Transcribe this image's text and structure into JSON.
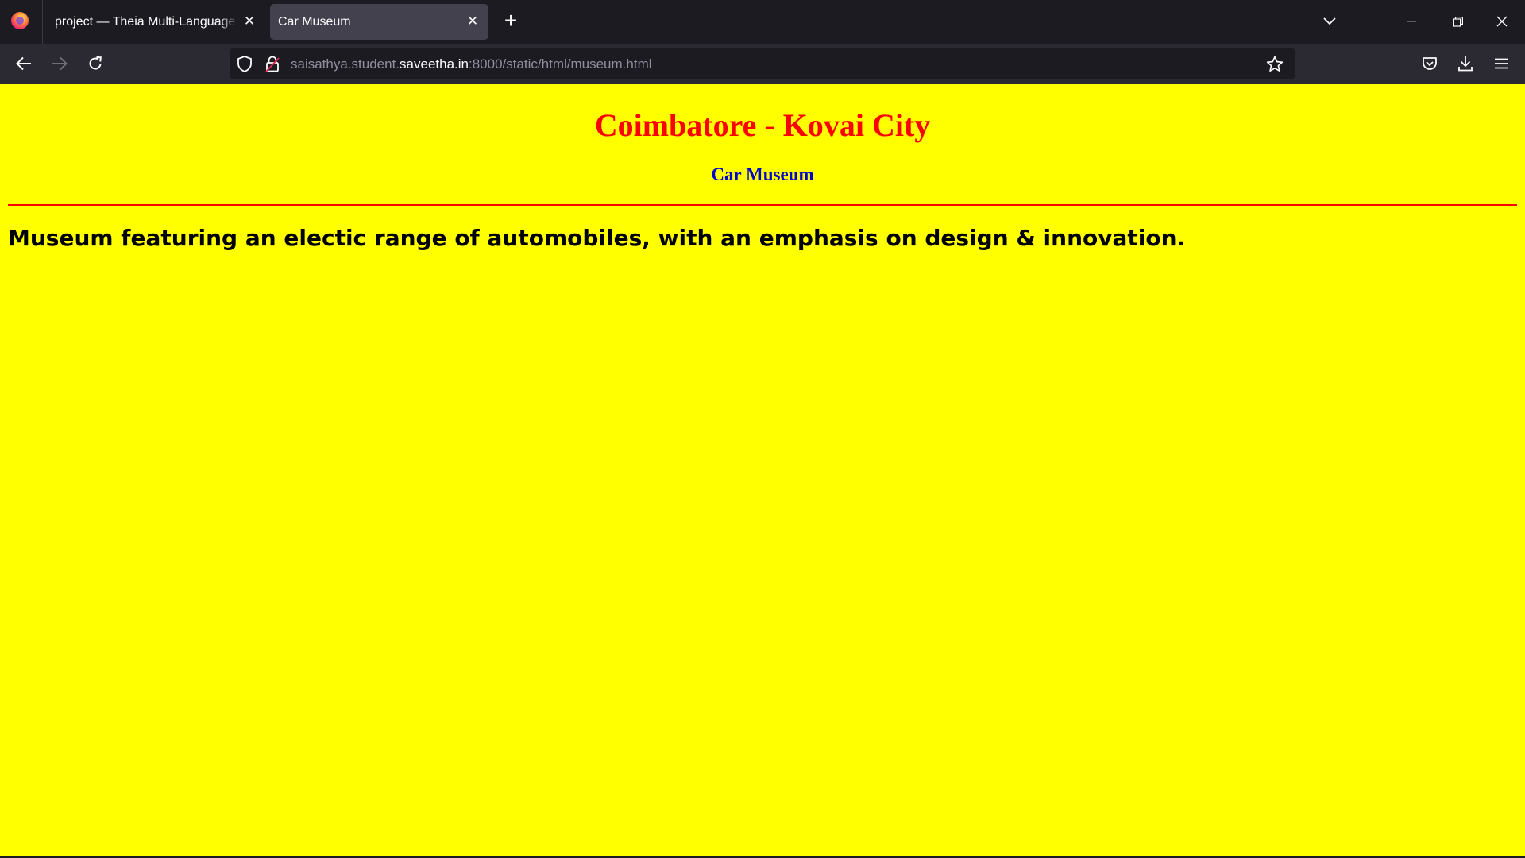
{
  "browser": {
    "tabs": [
      {
        "title": "project — Theia Multi-Language Example",
        "active": false
      },
      {
        "title": "Car Museum",
        "active": true
      }
    ],
    "url": {
      "prefix": "saisathya.student.",
      "domain": "saveetha.in",
      "suffix": ":8000/static/html/museum.html"
    }
  },
  "page": {
    "background": "#ffff00",
    "title": "Coimbatore - Kovai City",
    "title_color": "#ff0000",
    "subtitle": "Car Museum",
    "subtitle_color": "#0000cc",
    "rule_color": "#ff0000",
    "description": "Museum featuring an electic range of automobiles, with an emphasis on design & innovation."
  }
}
